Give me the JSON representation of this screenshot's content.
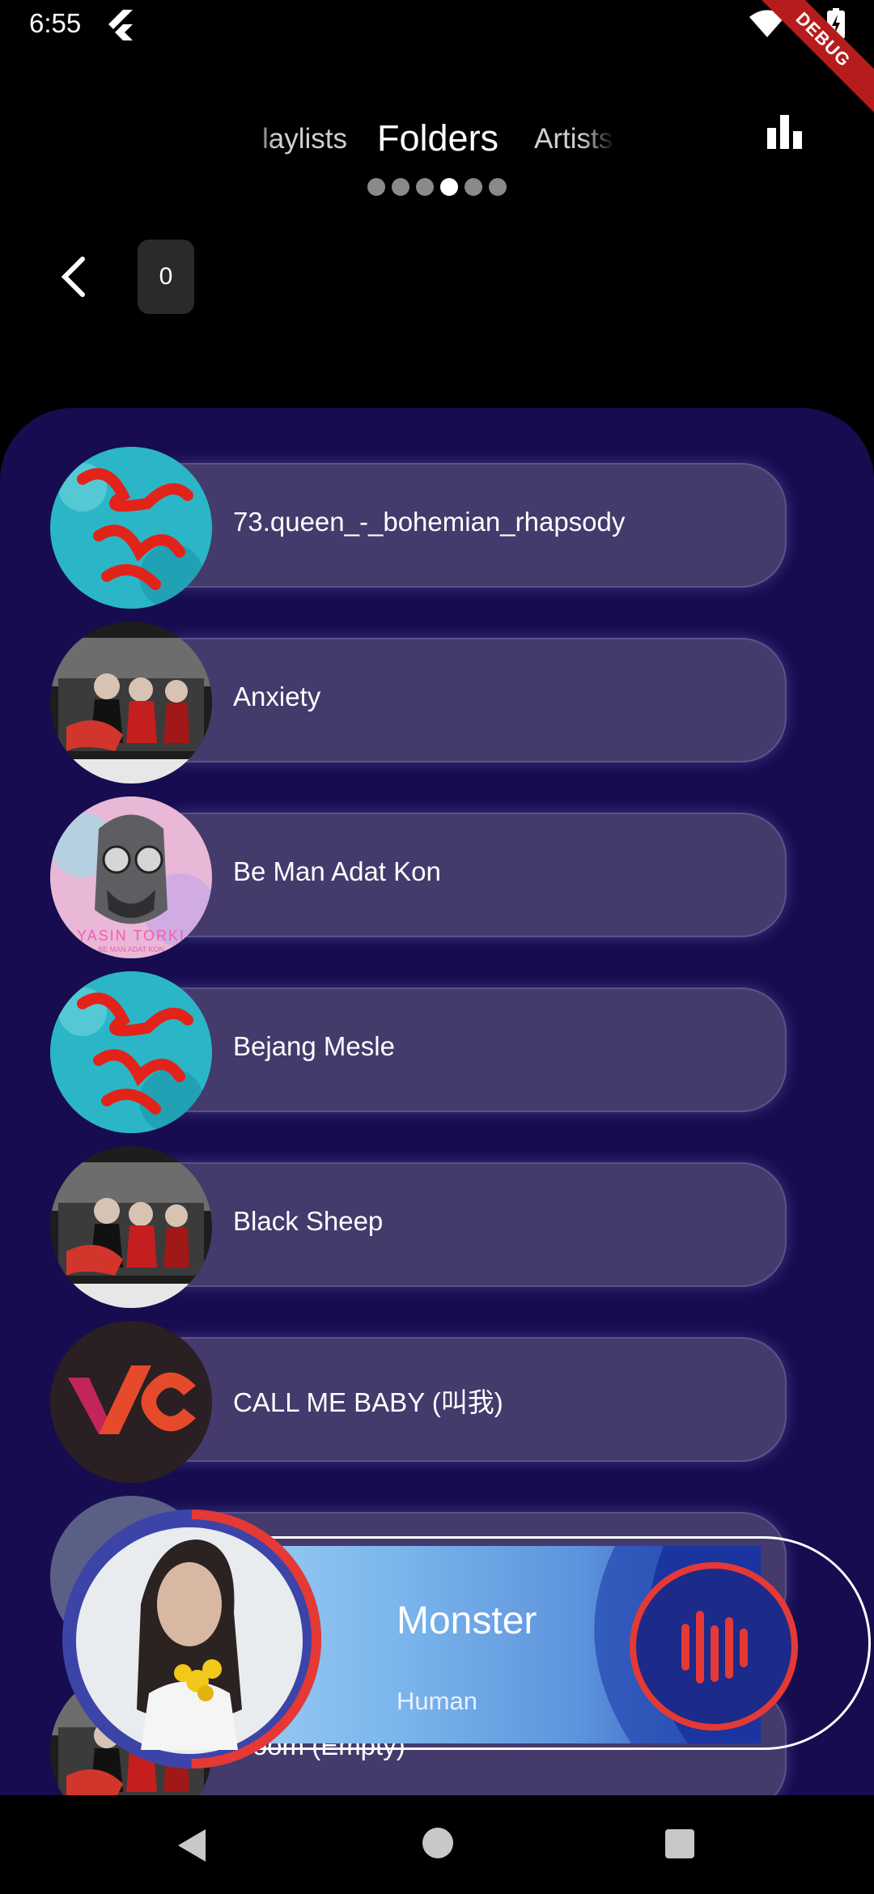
{
  "status_bar": {
    "time": "6:55",
    "debug_label": "DEBUG"
  },
  "tabs": {
    "prev_label": "laylists",
    "active_label": "Folders",
    "next_label": "Artists",
    "page_count": 6,
    "active_page": 4
  },
  "header": {
    "count": "0"
  },
  "folders": [
    {
      "title": "73.queen_-_bohemian_rhapsody",
      "art_icon": "bejang-mesle-cover"
    },
    {
      "title": "Anxiety",
      "art_icon": "band-car-cover"
    },
    {
      "title": "Be Man Adat Kon",
      "art_icon": "yasin-torki-cover",
      "art_text": "YASIN TORKI",
      "art_subtext": "BE MAN ADAT KON"
    },
    {
      "title": "Bejang Mesle",
      "art_icon": "bejang-mesle-cover"
    },
    {
      "title": "Black Sheep",
      "art_icon": "band-car-cover"
    },
    {
      "title": "CALL ME BABY (叫我)",
      "art_icon": "vc-logo-cover"
    },
    {
      "title": "",
      "art_icon": "hidden-row-cover"
    },
    {
      "title": "Doom (Empty)",
      "art_icon": "band-car-cover"
    }
  ],
  "player": {
    "title": "Monster",
    "artist": "Human",
    "progress": 0.5,
    "accent": "#e53935"
  },
  "colors": {
    "panel": "#160c4f",
    "pill": "#443a6c",
    "background": "#000000"
  }
}
